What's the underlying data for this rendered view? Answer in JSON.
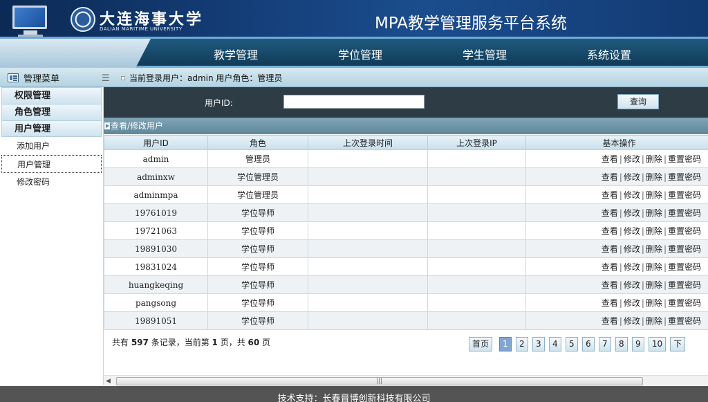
{
  "header": {
    "university_cn": "大连海事大学",
    "university_en": "DALIAN MARITIME UNIVERSITY",
    "app_title": "MPA教学管理服务平台系统"
  },
  "nav": [
    "教学管理",
    "学位管理",
    "学生管理",
    "系统设置"
  ],
  "infobar": {
    "menu_title": "管理菜单",
    "login_text": "当前登录用户：admin  用户角色：管理员"
  },
  "sidebar": {
    "groups": [
      "权限管理",
      "角色管理",
      "用户管理"
    ],
    "links": [
      "添加用户",
      "用户管理",
      "修改密码"
    ],
    "active_link": "用户管理"
  },
  "search": {
    "label": "用户ID:",
    "value": "",
    "button": "查询"
  },
  "section_title": "查看/修改用户",
  "table": {
    "headers": [
      "用户ID",
      "角色",
      "上次登录时间",
      "上次登录IP",
      "基本操作"
    ],
    "rows": [
      {
        "id": "admin",
        "role": "管理员",
        "last_time": "",
        "last_ip": ""
      },
      {
        "id": "adminxw",
        "role": "学位管理员",
        "last_time": "",
        "last_ip": ""
      },
      {
        "id": "adminmpa",
        "role": "学位管理员",
        "last_time": "",
        "last_ip": ""
      },
      {
        "id": "19761019",
        "role": "学位导师",
        "last_time": "",
        "last_ip": ""
      },
      {
        "id": "19721063",
        "role": "学位导师",
        "last_time": "",
        "last_ip": ""
      },
      {
        "id": "19891030",
        "role": "学位导师",
        "last_time": "",
        "last_ip": ""
      },
      {
        "id": "19831024",
        "role": "学位导师",
        "last_time": "",
        "last_ip": ""
      },
      {
        "id": "huangkeqing",
        "role": "学位导师",
        "last_time": "",
        "last_ip": ""
      },
      {
        "id": "pangsong",
        "role": "学位导师",
        "last_time": "",
        "last_ip": ""
      },
      {
        "id": "19891051",
        "role": "学位导师",
        "last_time": "",
        "last_ip": ""
      }
    ],
    "ops": [
      "查看",
      "修改",
      "删除",
      "重置密码"
    ]
  },
  "pagination": {
    "prefix": "共有 ",
    "total": "597",
    "mid1": " 条记录，当前第 ",
    "current": "1",
    "mid2": " 页，共 ",
    "pages": "60",
    "suffix": " 页",
    "first_label": "首页",
    "page_buttons": [
      "1",
      "2",
      "3",
      "4",
      "5",
      "6",
      "7",
      "8",
      "9",
      "10"
    ],
    "next_label": "下",
    "current_page": "1"
  },
  "footer": {
    "text": "技术支持：长春晋博创新科技有限公司"
  }
}
